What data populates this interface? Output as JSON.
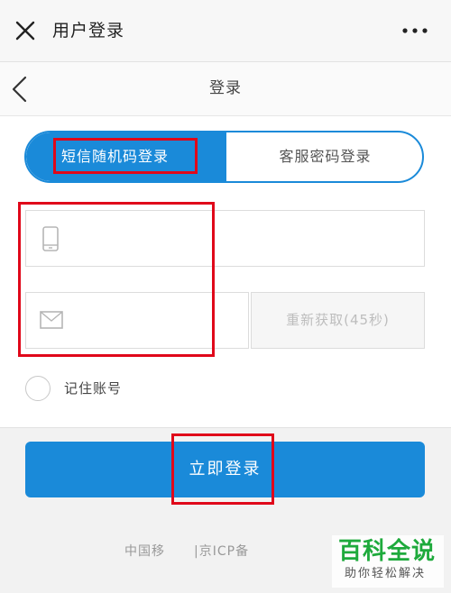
{
  "header": {
    "title": "用户登录"
  },
  "nav": {
    "title": "登录"
  },
  "tabs": {
    "sms": "短信随机码登录",
    "cs": "客服密码登录"
  },
  "form": {
    "phone_placeholder": "",
    "code_placeholder": "",
    "resend_label": "重新获取(45秒)",
    "remember_label": "记住账号",
    "remember_checked": false,
    "submit_label": "立即登录"
  },
  "footer": {
    "left": "中国移",
    "right": "|京ICP备"
  },
  "watermark": {
    "main": "百科全说",
    "sub": "助你轻松解决"
  },
  "colors": {
    "accent": "#1a8ad9",
    "highlight": "#e0081a",
    "watermark": "#1eaa3c"
  },
  "icons": [
    "close-icon",
    "more-icon",
    "back-icon",
    "phone-icon",
    "mail-icon"
  ]
}
